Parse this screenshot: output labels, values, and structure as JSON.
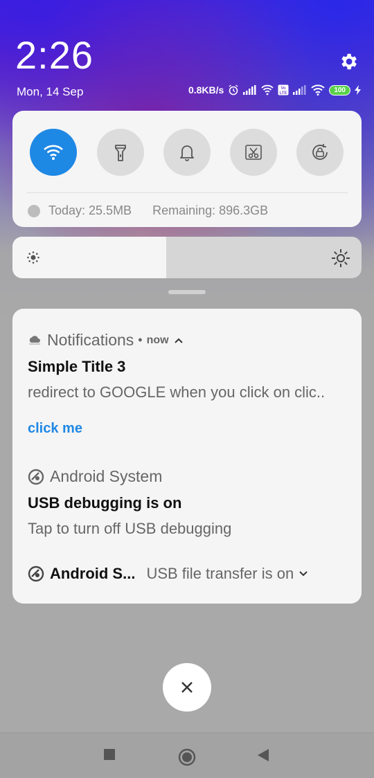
{
  "status_bar": {
    "time": "2:26",
    "date": "Mon, 14 Sep",
    "net_speed": "0.8KB/s",
    "battery": "100",
    "icons": [
      "alarm-icon",
      "signal-icon",
      "wifi-calling-icon",
      "volte-icon",
      "signal-icon",
      "wifi-icon",
      "battery-icon",
      "charging-icon"
    ]
  },
  "quick_settings": {
    "tiles": [
      {
        "name": "wifi",
        "icon": "wifi-icon",
        "active": true
      },
      {
        "name": "flashlight",
        "icon": "flashlight-icon",
        "active": false
      },
      {
        "name": "sound",
        "icon": "bell-icon",
        "active": false
      },
      {
        "name": "screenshot",
        "icon": "scissors-icon",
        "active": false
      },
      {
        "name": "auto-rotate",
        "icon": "rotate-lock-icon",
        "active": false
      }
    ],
    "data_today": "Today: 25.5MB",
    "data_remaining": "Remaining: 896.3GB",
    "brightness_level": 0.44
  },
  "notifications": {
    "app1": "Notifications",
    "app1_time": "now",
    "title1": "Simple Title 3",
    "text1": "redirect to GOOGLE when you click on clic..",
    "action1": "click me",
    "app2": "Android System",
    "title2": "USB debugging is on",
    "text2": "Tap to turn off USB debugging",
    "app3": "Android S...",
    "text3": "USB file transfer is on"
  },
  "colors": {
    "accent": "#1e88e5",
    "battery": "#5ad14a"
  }
}
